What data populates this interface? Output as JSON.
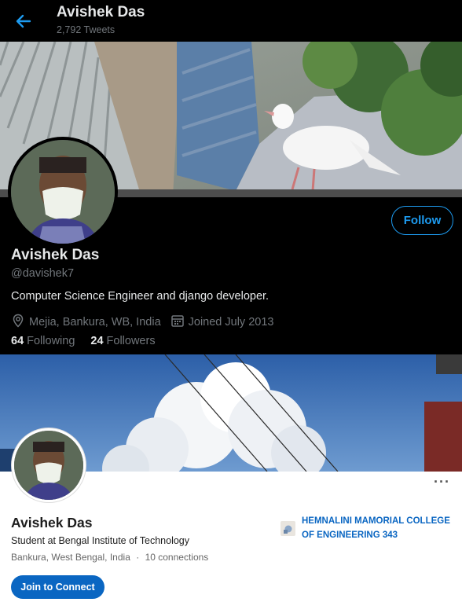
{
  "twitter": {
    "header": {
      "name": "Avishek Das",
      "tweet_count": "2,792 Tweets",
      "back_icon": "arrow-left-icon"
    },
    "profile": {
      "name": "Avishek Das",
      "handle": "@davishek7",
      "bio": "Computer Science Engineer and django developer.",
      "location": "Mejia, Bankura, WB, India",
      "joined": "Joined July 2013",
      "following_count": "64",
      "following_label": "Following",
      "followers_count": "24",
      "followers_label": "Followers",
      "follow_label": "Follow"
    },
    "colors": {
      "background": "#000000",
      "accent": "#1d9bf0",
      "text": "#e7e9ea",
      "muted": "#71767b"
    }
  },
  "linkedin": {
    "name": "Avishek Das",
    "headline": "Student at Bengal Institute of Technology",
    "location": "Bankura, West Bengal, India",
    "connections": "10 connections",
    "separator": "·",
    "education_line1": "HEMNALINI MAMORIAL COLLEGE",
    "education_line2": "OF ENGINEERING 343",
    "connect_label": "Join to Connect",
    "more_label": "···",
    "colors": {
      "accent": "#0a66c2",
      "text": "#1d1d1d",
      "muted": "#666666"
    }
  }
}
